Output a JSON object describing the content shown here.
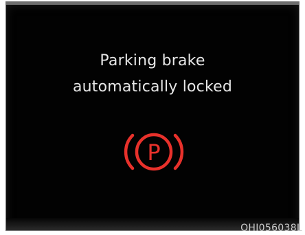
{
  "display": {
    "message_line1": "Parking brake",
    "message_line2": "automatically locked",
    "warning_icon": "parking-brake-icon",
    "warning_icon_letter": "P",
    "warning_color": "#e8312b",
    "background_color": "#020202",
    "text_color": "#e6e6e6"
  },
  "image_code": "OHI056038L"
}
